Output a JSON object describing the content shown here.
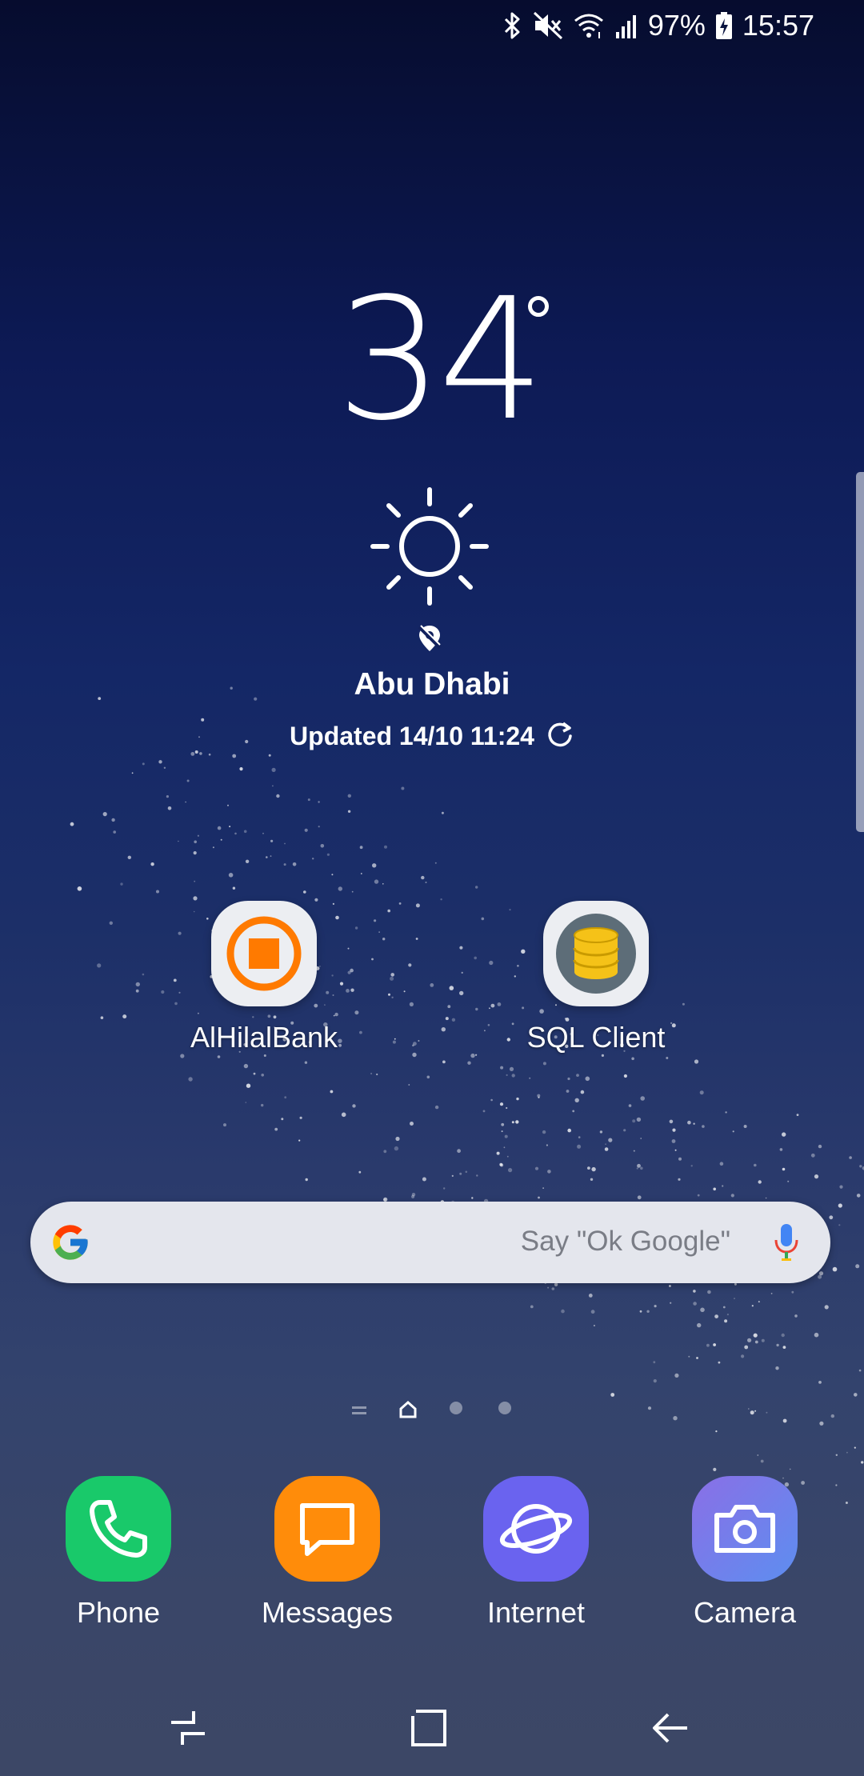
{
  "status_bar": {
    "battery": "97%",
    "time": "15:57",
    "icons": [
      "bluetooth-icon",
      "mute-icon",
      "wifi-icon",
      "signal-icon",
      "battery-charging-icon"
    ]
  },
  "weather": {
    "temperature": "34",
    "condition_icon": "sun-icon",
    "location": "Abu Dhabi",
    "updated": "Updated 14/10 11:24"
  },
  "home_apps": [
    {
      "label": "AlHilalBank",
      "icon": "alhilalbank-icon"
    },
    {
      "label": "SQL Client",
      "icon": "sql-client-icon"
    }
  ],
  "search": {
    "hint": "Say \"Ok Google\"",
    "icons": [
      "google-logo-icon",
      "mic-icon"
    ]
  },
  "page_indicator": {
    "pages": 4,
    "current": 1
  },
  "dock": [
    {
      "label": "Phone",
      "icon": "phone-icon",
      "color": "#19c96a"
    },
    {
      "label": "Messages",
      "icon": "messages-icon",
      "color": "#ff8c0a"
    },
    {
      "label": "Internet",
      "icon": "internet-icon",
      "color": "#6a63ef"
    },
    {
      "label": "Camera",
      "icon": "camera-icon",
      "color": "#6d7fe8"
    }
  ],
  "nav_bar": [
    "recents-button",
    "home-button",
    "back-button"
  ],
  "colors": {
    "accent_orange": "#ff7a00",
    "sql_yellow": "#f5c218"
  }
}
